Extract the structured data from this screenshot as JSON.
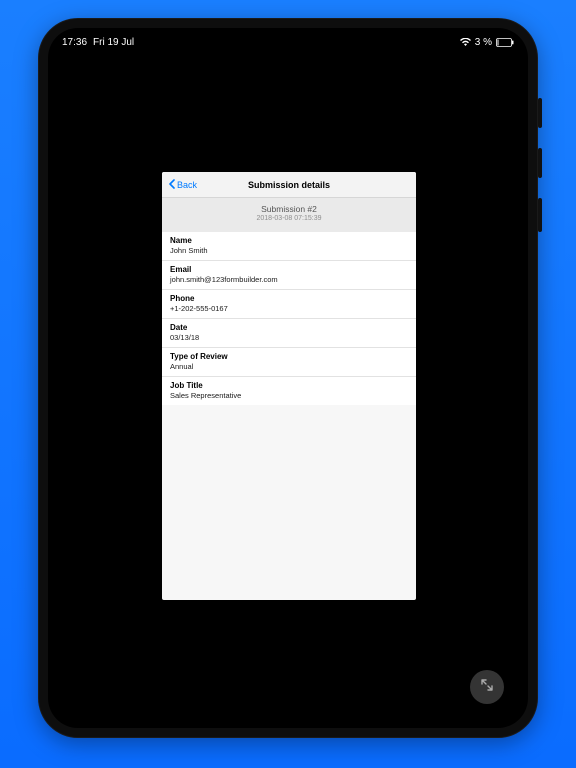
{
  "status": {
    "time": "17:36",
    "date": "Fri 19 Jul",
    "battery_pct": "3 %"
  },
  "nav": {
    "back_label": "Back",
    "title": "Submission details"
  },
  "subheader": {
    "title": "Submission #2",
    "timestamp": "2018-03-08 07:15:39"
  },
  "fields": [
    {
      "label": "Name",
      "value": "John Smith"
    },
    {
      "label": "Email",
      "value": "john.smith@123formbuilder.com"
    },
    {
      "label": "Phone",
      "value": "+1-202-555-0167"
    },
    {
      "label": "Date",
      "value": "03/13/18"
    },
    {
      "label": "Type of Review",
      "value": "Annual"
    },
    {
      "label": "Job Title",
      "value": "Sales Representative"
    }
  ]
}
